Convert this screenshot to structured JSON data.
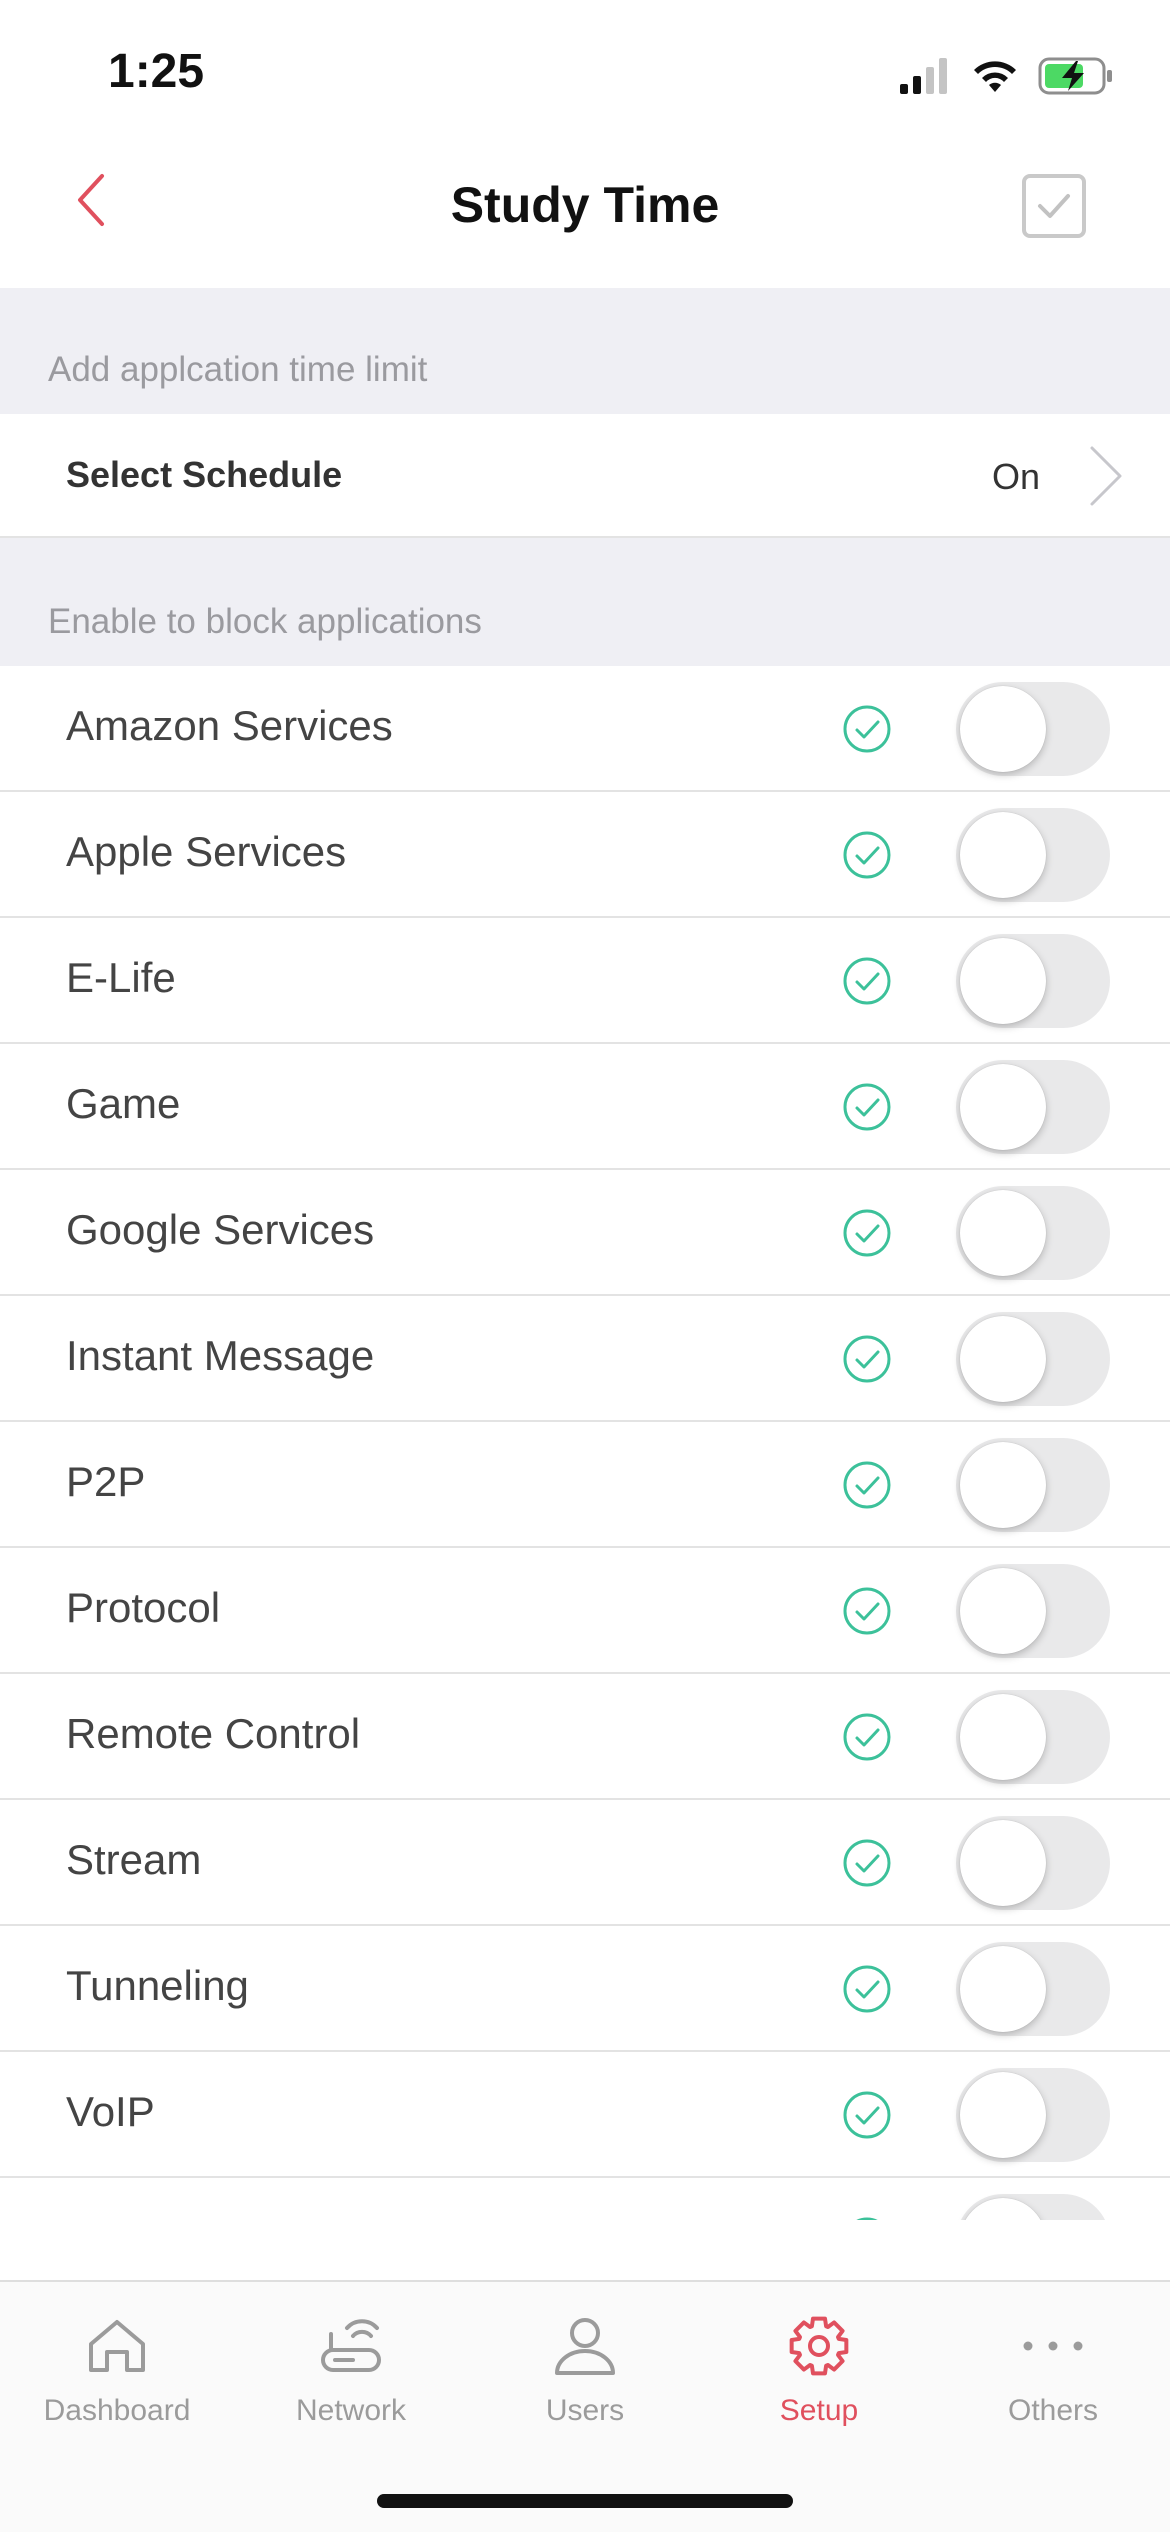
{
  "status_bar": {
    "time": "1:25",
    "icons": [
      "cellular-signal-icon",
      "wifi-icon",
      "battery-charging-icon"
    ]
  },
  "nav": {
    "title": "Study Time",
    "back_icon": "chevron-left-icon",
    "confirm_icon": "checkbox-icon",
    "accent_color": "#e0505e"
  },
  "sections": {
    "time_limit_header": "Add applcation time limit",
    "block_apps_header": "Enable to block applications"
  },
  "schedule": {
    "label": "Select Schedule",
    "value": "On"
  },
  "apps": [
    {
      "label": "Amazon Services",
      "enabled": false
    },
    {
      "label": "Apple Services",
      "enabled": false
    },
    {
      "label": "E-Life",
      "enabled": false
    },
    {
      "label": "Game",
      "enabled": false
    },
    {
      "label": "Google Services",
      "enabled": false
    },
    {
      "label": "Instant Message",
      "enabled": false
    },
    {
      "label": "P2P",
      "enabled": false
    },
    {
      "label": "Protocol",
      "enabled": false
    },
    {
      "label": "Remote Control",
      "enabled": false
    },
    {
      "label": "Stream",
      "enabled": false
    },
    {
      "label": "Tunneling",
      "enabled": false
    },
    {
      "label": "VoIP",
      "enabled": false
    },
    {
      "label": "",
      "enabled": false
    }
  ],
  "check_color": "#3cc19a",
  "tab_bar": {
    "tabs": [
      {
        "label": "Dashboard",
        "icon": "home-icon",
        "active": false
      },
      {
        "label": "Network",
        "icon": "router-icon",
        "active": false
      },
      {
        "label": "Users",
        "icon": "user-icon",
        "active": false
      },
      {
        "label": "Setup",
        "icon": "gear-icon",
        "active": true
      },
      {
        "label": "Others",
        "icon": "more-icon",
        "active": false
      }
    ]
  }
}
